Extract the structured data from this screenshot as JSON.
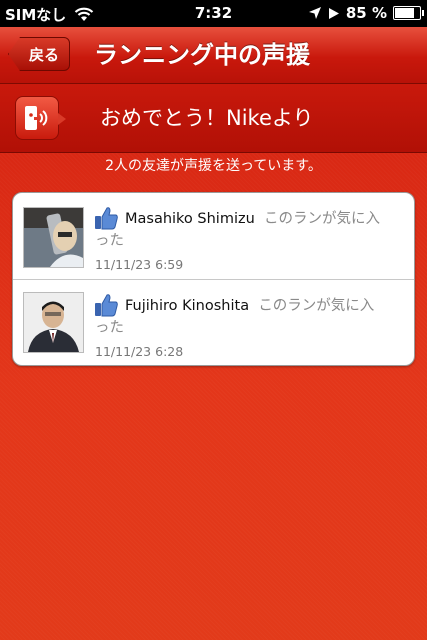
{
  "status_bar": {
    "carrier": "SIMなし",
    "time": "7:32",
    "battery_percent": "85 %",
    "battery_level": 0.85
  },
  "nav": {
    "back_label": "戻る",
    "title": "ランニング中の声援"
  },
  "banner": {
    "text": "おめでとう！Nikeより",
    "icon": "cheer-speaker-icon"
  },
  "subtitle": "2人の友達が声援を送っています。",
  "cheers": [
    {
      "name": "Masahiko Shimizu",
      "message_part1": "このランが気に入",
      "message_part2": "った",
      "timestamp": "11/11/23  6:59"
    },
    {
      "name": "Fujihiro Kinoshita",
      "message_part1": "このランが気に入",
      "message_part2": "った",
      "timestamp": "11/11/23  6:28"
    }
  ],
  "colors": {
    "brand_red": "#d62a14",
    "like_blue": "#4a78c8"
  }
}
